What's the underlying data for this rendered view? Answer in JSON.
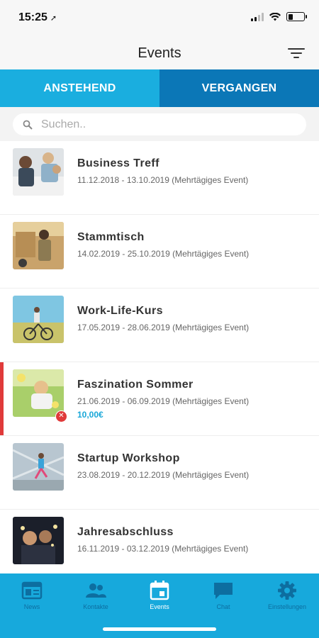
{
  "status_bar": {
    "time": "15:25",
    "location_glyph": "➚",
    "battery_level": 0.3
  },
  "header": {
    "title": "Events",
    "filter_icon": "filter-icon"
  },
  "tabs": [
    {
      "label": "ANSTEHEND",
      "active": true
    },
    {
      "label": "VERGANGEN",
      "active": false
    }
  ],
  "search": {
    "placeholder": "Suchen..",
    "value": ""
  },
  "events": [
    {
      "title": "Business Treff",
      "dates": "11.12.2018 - 13.10.2019 (Mehrtägiges Event)",
      "price": "",
      "cancelled": false
    },
    {
      "title": "Stammtisch",
      "dates": "14.02.2019 - 25.10.2019 (Mehrtägiges Event)",
      "price": "",
      "cancelled": false
    },
    {
      "title": "Work-Life-Kurs",
      "dates": "17.05.2019 - 28.06.2019 (Mehrtägiges Event)",
      "price": "",
      "cancelled": false
    },
    {
      "title": "Faszination Sommer",
      "dates": "21.06.2019 - 06.09.2019 (Mehrtägiges Event)",
      "price": "10,00€",
      "cancelled": true
    },
    {
      "title": "Startup Workshop",
      "dates": "23.08.2019 - 20.12.2019 (Mehrtägiges Event)",
      "price": "",
      "cancelled": false
    },
    {
      "title": "Jahresabschluss",
      "dates": "16.11.2019 - 03.12.2019 (Mehrtägiges Event)",
      "price": "",
      "cancelled": false
    }
  ],
  "bottom_nav": [
    {
      "label": "News",
      "icon": "newspaper-icon",
      "active": false
    },
    {
      "label": "Kontakte",
      "icon": "contacts-icon",
      "active": false
    },
    {
      "label": "Events",
      "icon": "calendar-icon",
      "active": true
    },
    {
      "label": "Chat",
      "icon": "chat-icon",
      "active": false
    },
    {
      "label": "Einstellungen",
      "icon": "gear-icon",
      "active": false
    }
  ],
  "colors": {
    "accent": "#1aaedf",
    "tab_inactive": "#0b77b7",
    "highlight": "#e03a3a",
    "price": "#18a7d8"
  }
}
